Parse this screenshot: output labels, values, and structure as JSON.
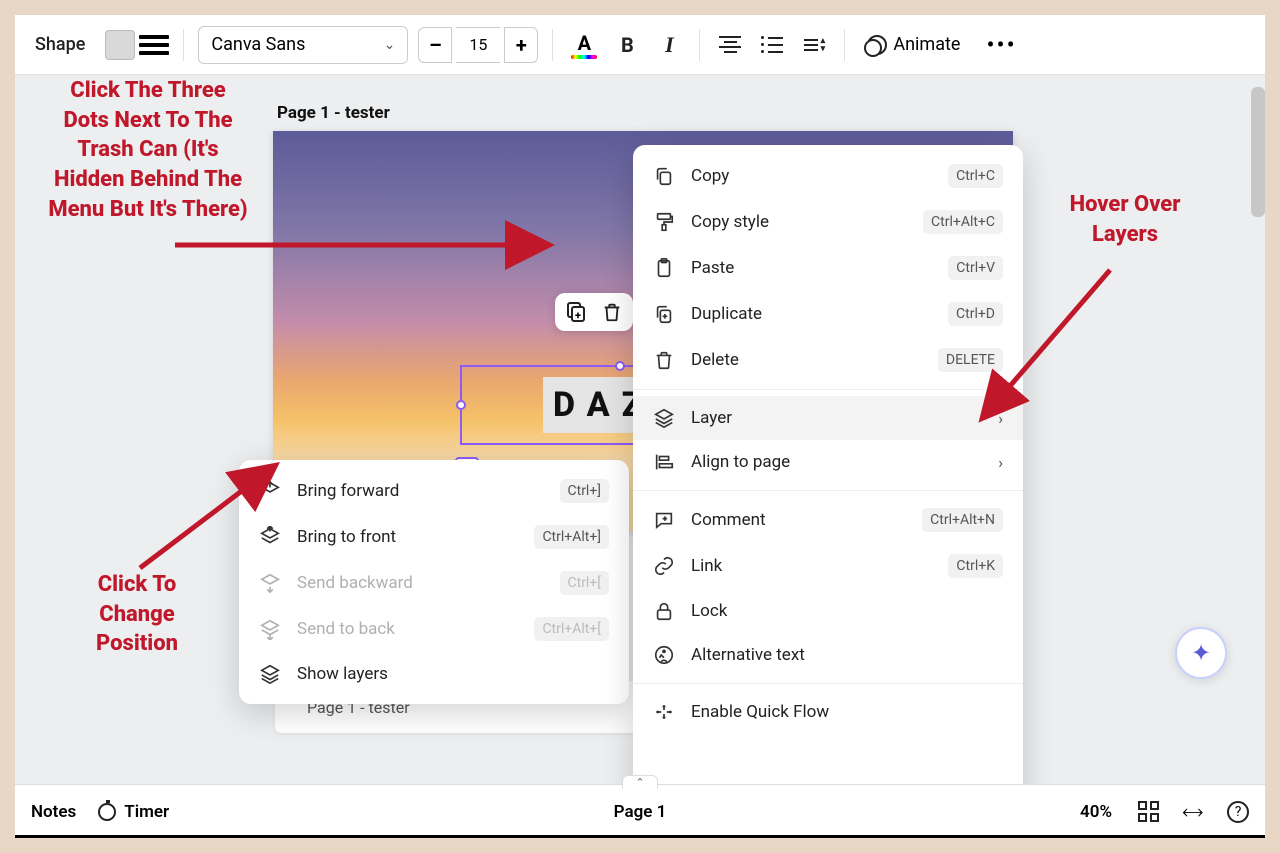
{
  "toolbar": {
    "shape_label": "Shape",
    "font_name": "Canva Sans",
    "font_size": "15",
    "animate_label": "Animate"
  },
  "canvas": {
    "page_title": "Page 1 - tester",
    "selected_text": "DAZZ",
    "strip_label": "Page 1 - tester"
  },
  "main_menu": [
    {
      "id": "copy",
      "label": "Copy",
      "shortcut": "Ctrl+C",
      "icon": "copy"
    },
    {
      "id": "copy-style",
      "label": "Copy style",
      "shortcut": "Ctrl+Alt+C",
      "icon": "roller"
    },
    {
      "id": "paste",
      "label": "Paste",
      "shortcut": "Ctrl+V",
      "icon": "clipboard"
    },
    {
      "id": "duplicate",
      "label": "Duplicate",
      "shortcut": "Ctrl+D",
      "icon": "duplicate"
    },
    {
      "id": "delete",
      "label": "Delete",
      "shortcut": "DELETE",
      "icon": "trash"
    },
    {
      "sep": true
    },
    {
      "id": "layer",
      "label": "Layer",
      "chev": true,
      "icon": "layers",
      "hover": true
    },
    {
      "id": "align",
      "label": "Align to page",
      "chev": true,
      "icon": "align"
    },
    {
      "sep": true
    },
    {
      "id": "comment",
      "label": "Comment",
      "shortcut": "Ctrl+Alt+N",
      "icon": "comment"
    },
    {
      "id": "link",
      "label": "Link",
      "shortcut": "Ctrl+K",
      "icon": "link"
    },
    {
      "id": "lock",
      "label": "Lock",
      "icon": "lock"
    },
    {
      "id": "alt-text",
      "label": "Alternative text",
      "icon": "alt"
    },
    {
      "sep": true
    },
    {
      "id": "quick-flow",
      "label": "Enable Quick Flow",
      "icon": "flow"
    }
  ],
  "sub_menu": [
    {
      "id": "bring-forward",
      "label": "Bring forward",
      "shortcut": "Ctrl+]",
      "icon": "forward"
    },
    {
      "id": "bring-front",
      "label": "Bring to front",
      "shortcut": "Ctrl+Alt+]",
      "icon": "front"
    },
    {
      "id": "send-backward",
      "label": "Send backward",
      "shortcut": "Ctrl+[",
      "icon": "backward",
      "disabled": true
    },
    {
      "id": "send-back",
      "label": "Send to back",
      "shortcut": "Ctrl+Alt+[",
      "icon": "back",
      "disabled": true
    },
    {
      "id": "show-layers",
      "label": "Show layers",
      "icon": "layers"
    }
  ],
  "bottom": {
    "notes": "Notes",
    "timer": "Timer",
    "page_indicator": "Page 1",
    "zoom": "40%"
  },
  "annotations": {
    "a1": "Click The Three Dots Next To The Trash Can (It's Hidden Behind The Menu But It's There)",
    "a2": "Hover Over Layers",
    "a3": "Click To Change Position"
  }
}
